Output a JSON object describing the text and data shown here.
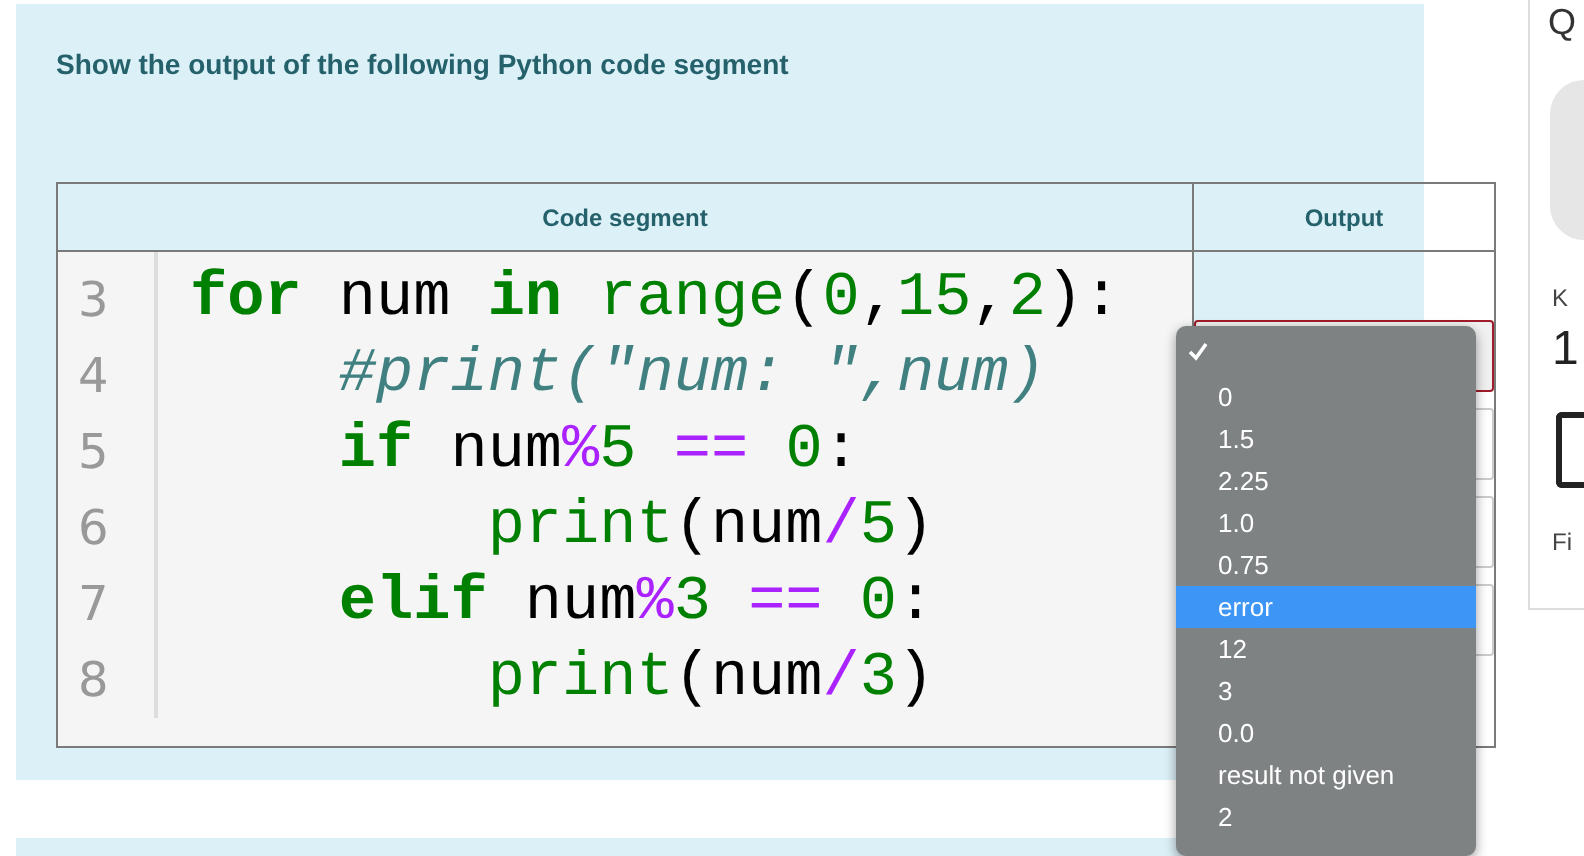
{
  "question": {
    "prompt": "Show the output of the following Python code segment"
  },
  "table": {
    "columns": [
      "Code segment",
      "Output"
    ],
    "code_lines": [
      {
        "number": "3",
        "tokens": [
          {
            "text": "for",
            "kind": "keyword"
          },
          {
            "text": " num ",
            "kind": "name"
          },
          {
            "text": "in",
            "kind": "keyword"
          },
          {
            "text": " range",
            "kind": "builtin"
          },
          {
            "text": "(",
            "kind": "name"
          },
          {
            "text": "0",
            "kind": "number"
          },
          {
            "text": ",",
            "kind": "name"
          },
          {
            "text": "15",
            "kind": "number"
          },
          {
            "text": ",",
            "kind": "name"
          },
          {
            "text": "2",
            "kind": "number"
          },
          {
            "text": "):",
            "kind": "name"
          }
        ]
      },
      {
        "number": "4",
        "tokens": [
          {
            "text": "    #print(\"num: \",num)",
            "kind": "comment"
          }
        ]
      },
      {
        "number": "5",
        "tokens": [
          {
            "text": "    if",
            "kind": "keyword"
          },
          {
            "text": " num",
            "kind": "name"
          },
          {
            "text": "%",
            "kind": "operator"
          },
          {
            "text": "5",
            "kind": "number"
          },
          {
            "text": " == ",
            "kind": "operator"
          },
          {
            "text": "0",
            "kind": "number"
          },
          {
            "text": ":",
            "kind": "name"
          }
        ]
      },
      {
        "number": "6",
        "tokens": [
          {
            "text": "        print",
            "kind": "builtin"
          },
          {
            "text": "(num",
            "kind": "name"
          },
          {
            "text": "/",
            "kind": "operator"
          },
          {
            "text": "5",
            "kind": "number"
          },
          {
            "text": ")",
            "kind": "name"
          }
        ]
      },
      {
        "number": "7",
        "tokens": [
          {
            "text": "    elif",
            "kind": "keyword"
          },
          {
            "text": " num",
            "kind": "name"
          },
          {
            "text": "%",
            "kind": "operator"
          },
          {
            "text": "3",
            "kind": "number"
          },
          {
            "text": " == ",
            "kind": "operator"
          },
          {
            "text": "0",
            "kind": "number"
          },
          {
            "text": ":",
            "kind": "name"
          }
        ]
      },
      {
        "number": "8",
        "tokens": [
          {
            "text": "        print",
            "kind": "builtin"
          },
          {
            "text": "(num",
            "kind": "name"
          },
          {
            "text": "/",
            "kind": "operator"
          },
          {
            "text": "3",
            "kind": "number"
          },
          {
            "text": ")",
            "kind": "name"
          }
        ]
      }
    ],
    "answers": [
      {
        "invalid": true,
        "open": true
      },
      {
        "invalid": false,
        "open": false
      },
      {
        "invalid": false,
        "open": false
      },
      {
        "invalid": false,
        "open": false
      }
    ]
  },
  "dropdown_menu": {
    "options": [
      {
        "checked": true,
        "highlighted": false
      },
      {
        "label": "0",
        "checked": false,
        "highlighted": false
      },
      {
        "label": "1.5",
        "checked": false,
        "highlighted": false
      },
      {
        "label": "2.25",
        "checked": false,
        "highlighted": false
      },
      {
        "label": "1.0",
        "checked": false,
        "highlighted": false
      },
      {
        "label": "0.75",
        "checked": false,
        "highlighted": false
      },
      {
        "label": "error",
        "checked": false,
        "highlighted": true
      },
      {
        "label": "12",
        "checked": false,
        "highlighted": false
      },
      {
        "label": "3",
        "checked": false,
        "highlighted": false
      },
      {
        "label": "0.0",
        "checked": false,
        "highlighted": false
      },
      {
        "label": "result not given",
        "checked": false,
        "highlighted": false
      },
      {
        "label": "2",
        "checked": false,
        "highlighted": false
      }
    ]
  },
  "side_panel": {
    "heading": "Q",
    "label": "K",
    "value": "1",
    "caption": "Fi"
  }
}
